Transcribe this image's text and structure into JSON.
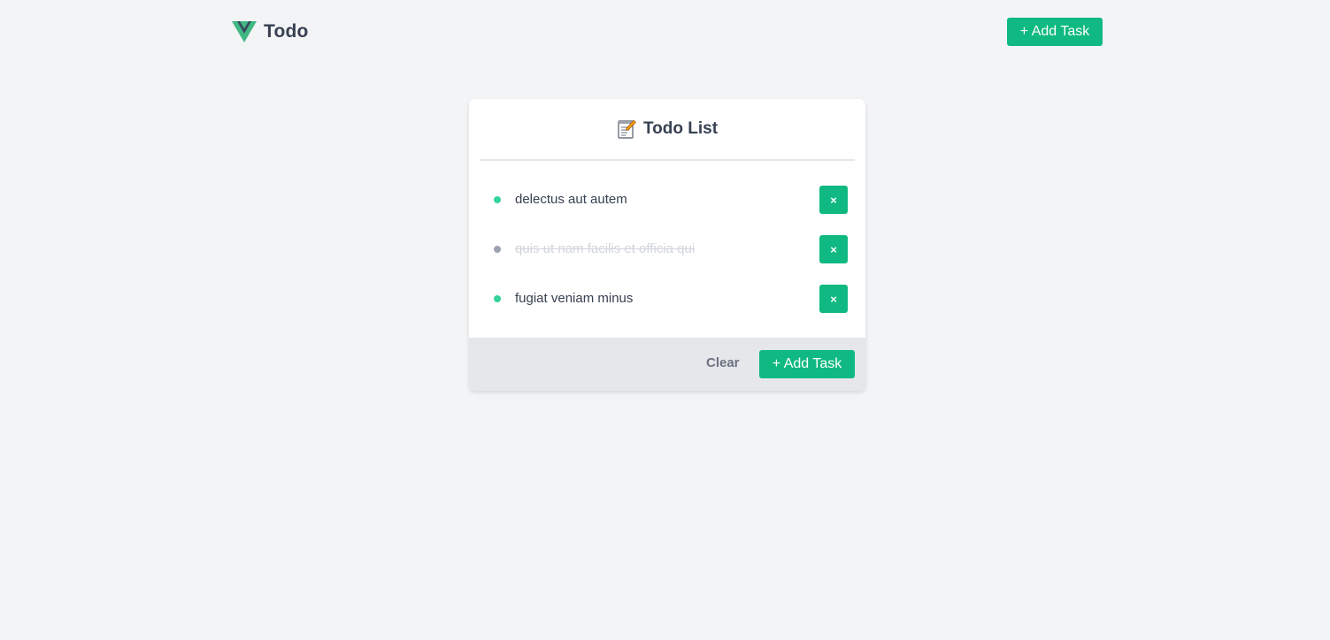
{
  "header": {
    "brand_title": "Todo",
    "add_task_label": "+ Add Task"
  },
  "card": {
    "title": "Todo List",
    "title_icon": "memo-icon",
    "tasks": [
      {
        "text": "delectus aut autem",
        "completed": false,
        "delete_label": "×"
      },
      {
        "text": "quis ut nam facilis et officia qui",
        "completed": true,
        "delete_label": "×"
      },
      {
        "text": "fugiat veniam minus",
        "completed": false,
        "delete_label": "×"
      }
    ],
    "footer": {
      "clear_label": "Clear",
      "add_task_label": "+ Add Task"
    }
  },
  "colors": {
    "accent": "#10b981",
    "dot_active": "#34d399",
    "dot_done": "#9ca3af",
    "background": "#f3f4f6",
    "footer_bg": "#e5e7eb"
  }
}
